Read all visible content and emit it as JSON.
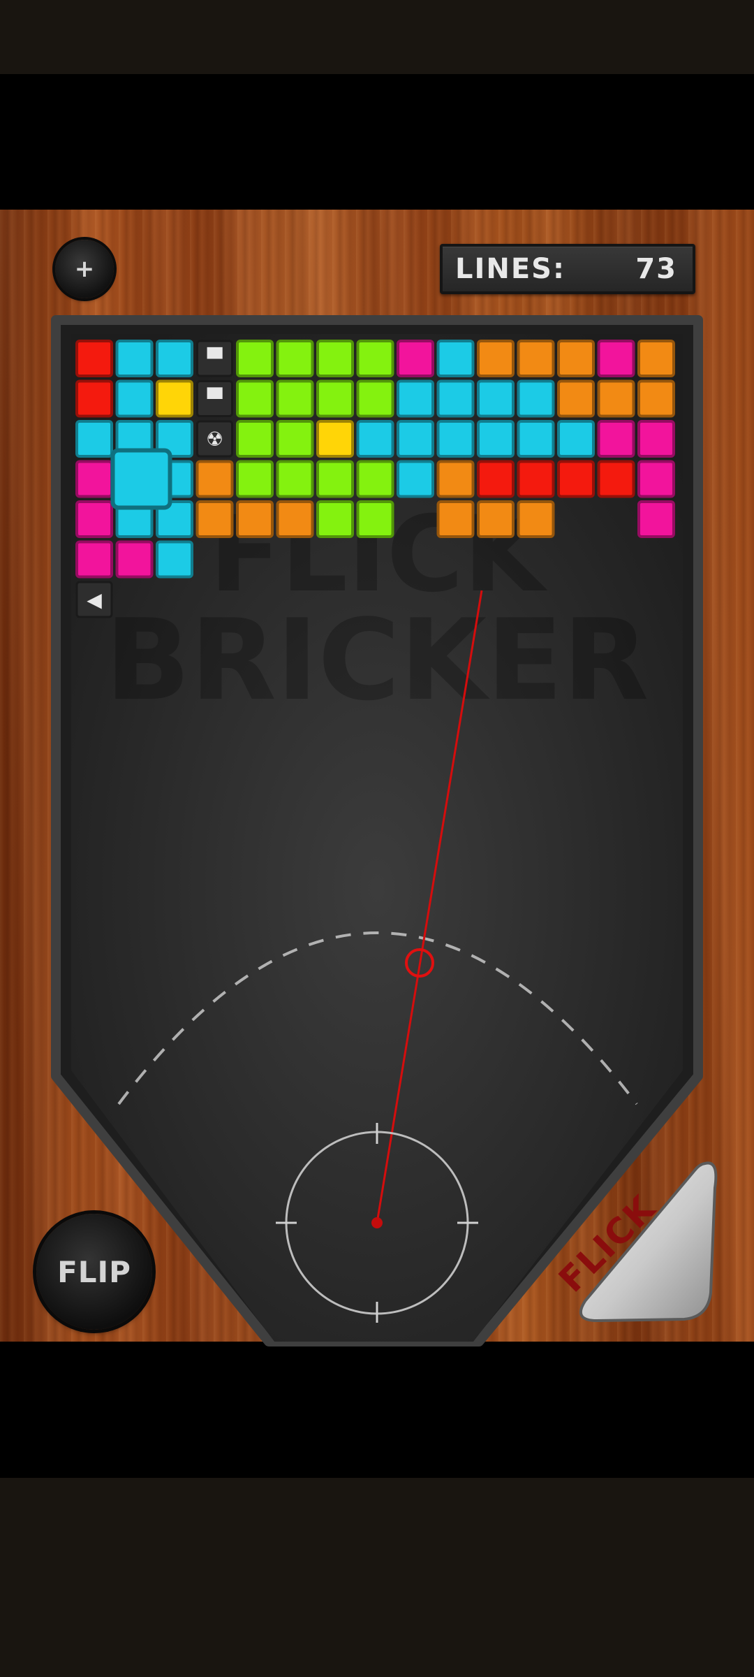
{
  "hud": {
    "lines_label": "LINES:",
    "lines_value": "73",
    "menu_button_label": "+",
    "flip_button_label": "FLIP",
    "flick_button_label": "FLICK"
  },
  "watermark": {
    "line1": "FLICK",
    "line2": "BRICKER"
  },
  "colors": {
    "r": "#f41a0e",
    "c": "#1ccbe6",
    "y": "#ffd507",
    "g": "#84f20f",
    "o": "#f28a14",
    "m": "#f2149c",
    "k": "#3a3a3a",
    "aim_line": "#d40d0d"
  },
  "bricks": [
    "rccDggggmcoooo mo",
    "rcyDggggccccooo o",
    "cccAggyccccccmm",
    "m  cogggcorrrrm",
    "mcc oooggooo    m",
    "mmc",
    "B"
  ],
  "brick_grid": [
    [
      "r",
      "c",
      "c",
      "D",
      "g",
      "g",
      "g",
      "g",
      "m",
      "c",
      "o",
      "o",
      "o",
      "m",
      "o"
    ],
    [
      "r",
      "c",
      "y",
      "D",
      "g",
      "g",
      "g",
      "g",
      "c",
      "c",
      "c",
      "c",
      "o",
      "o",
      "o"
    ],
    [
      "c",
      "c",
      "c",
      "A",
      "g",
      "g",
      "y",
      "c",
      "c",
      "c",
      "c",
      "c",
      "c",
      "m",
      "m"
    ],
    [
      "m",
      "",
      "c",
      "o",
      "g",
      "g",
      "g",
      "g",
      "c",
      "o",
      "r",
      "r",
      "r",
      "r",
      "m"
    ],
    [
      "m",
      "c",
      "c",
      "o",
      "o",
      "o",
      "g",
      "g",
      "",
      "o",
      "o",
      "o",
      "",
      "",
      "m"
    ],
    [
      "m",
      "m",
      "c",
      "",
      "",
      "",
      "",
      "",
      "",
      "",
      "",
      "",
      "",
      "",
      ""
    ],
    [
      "B",
      "",
      "",
      "",
      "",
      "",
      "",
      "",
      "",
      "",
      "",
      "",
      "",
      "",
      ""
    ]
  ],
  "special_icons": {
    "D": "anvil-icon",
    "A": "radiation-icon",
    "B": "speaker-icon"
  },
  "active_block": {
    "color": "c",
    "row": 3,
    "col": 1
  }
}
